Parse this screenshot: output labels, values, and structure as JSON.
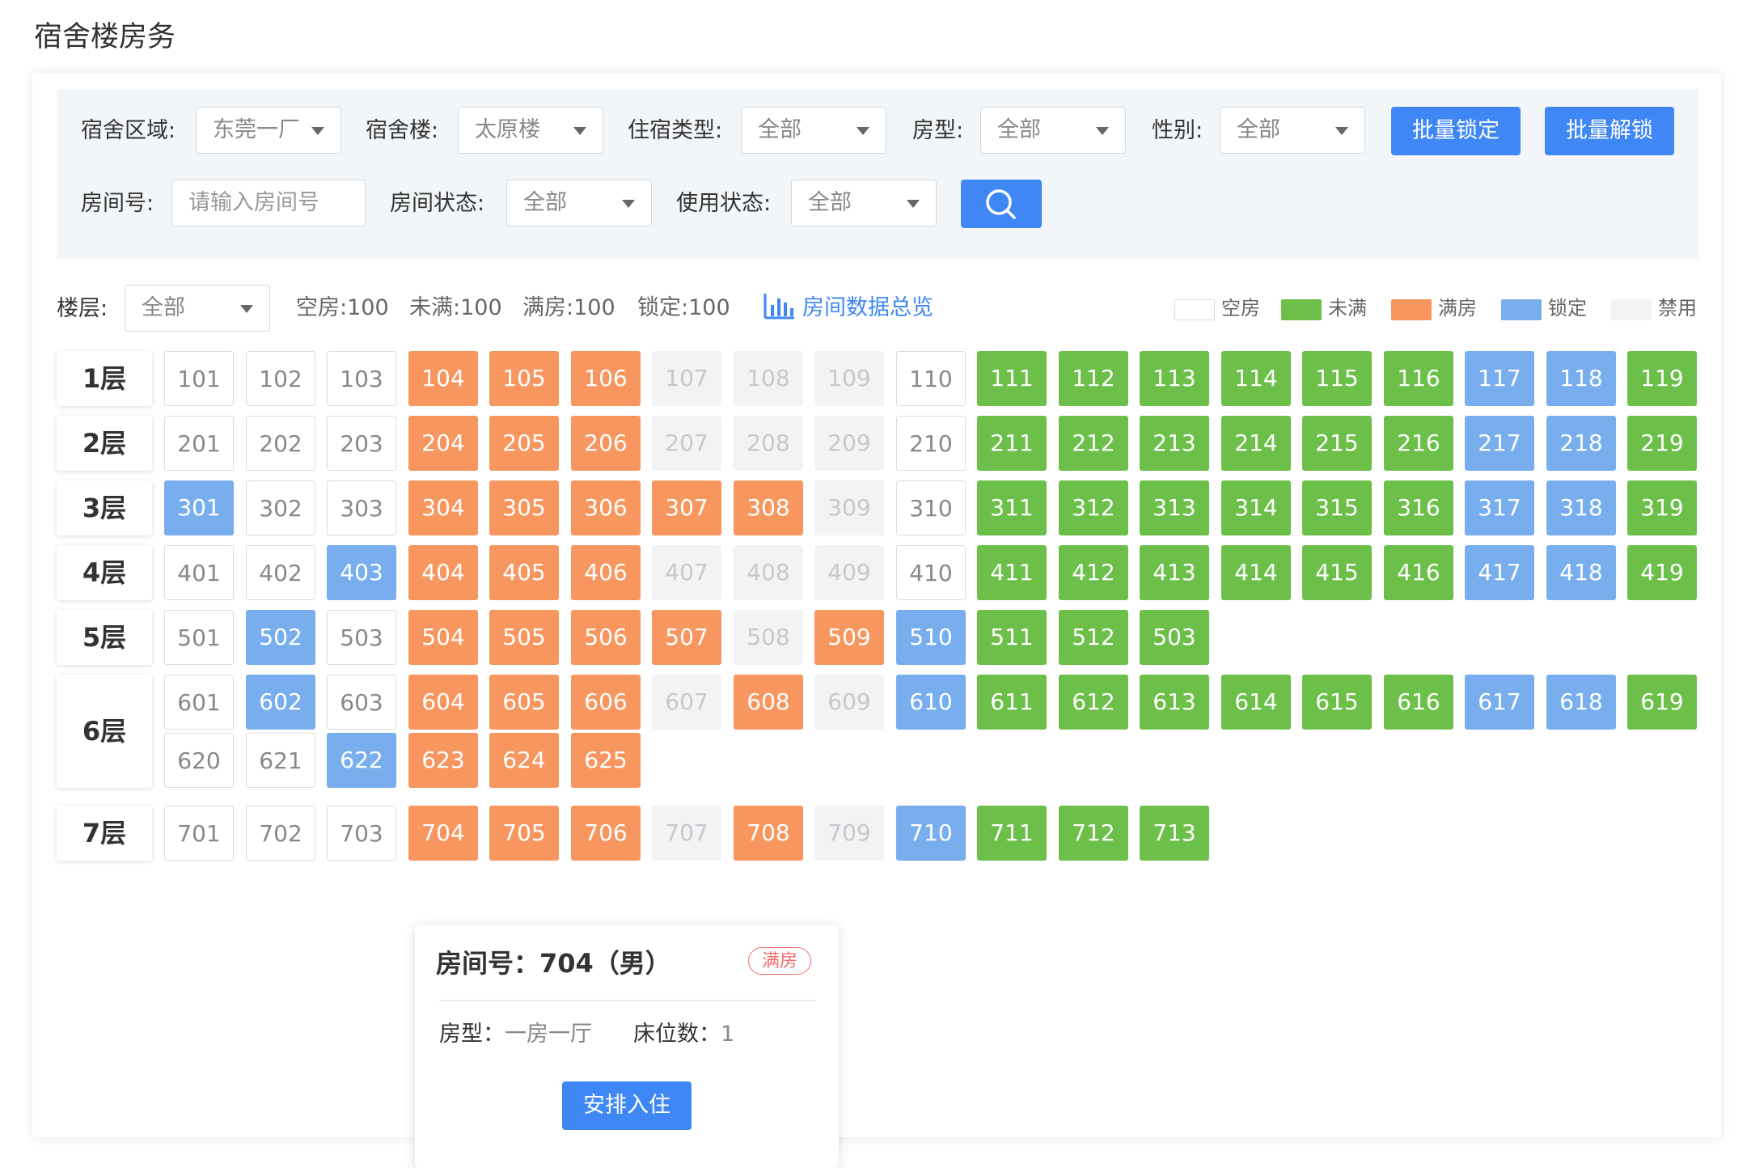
{
  "page_title": "宿舍楼房务",
  "filters": {
    "area_label": "宿舍区域:",
    "area_value": "东莞一厂",
    "building_label": "宿舍楼:",
    "building_value": "太原楼",
    "stay_type_label": "住宿类型:",
    "stay_type_value": "全部",
    "room_type_label": "房型:",
    "room_type_value": "全部",
    "gender_label": "性别:",
    "gender_value": "全部",
    "batch_lock": "批量锁定",
    "batch_unlock": "批量解锁",
    "room_no_label": "房间号:",
    "room_no_placeholder": "请输入房间号",
    "room_status_label": "房间状态:",
    "room_status_value": "全部",
    "use_status_label": "使用状态:",
    "use_status_value": "全部",
    "search_icon": "search-icon"
  },
  "floor_filter": {
    "label": "楼层:",
    "value": "全部"
  },
  "stats": {
    "empty": "空房:100",
    "not_full": "未满:100",
    "full": "满房:100",
    "locked": "锁定:100"
  },
  "overview": {
    "icon": "bar-chart-icon",
    "label": "房间数据总览"
  },
  "legend": [
    {
      "label": "空房",
      "color": "#ffffff"
    },
    {
      "label": "未满",
      "color": "#6cc04a"
    },
    {
      "label": "满房",
      "color": "#f7975f"
    },
    {
      "label": "锁定",
      "color": "#78aeee"
    },
    {
      "label": "禁用",
      "color": "#f3f3f5"
    }
  ],
  "status_colors": {
    "E": "empty",
    "G": "not-full",
    "O": "full",
    "B": "locked",
    "D": "disabled"
  },
  "floors": [
    {
      "label": "1层",
      "rows": [
        {
          "rooms": [
            "101",
            "102",
            "103",
            "104",
            "105",
            "106",
            "107",
            "108",
            "109",
            "110",
            "111",
            "112",
            "113",
            "114",
            "115",
            "116",
            "117",
            "118",
            "119"
          ],
          "status": "EEEOOODDDEGGGGGGBBG"
        }
      ]
    },
    {
      "label": "2层",
      "rows": [
        {
          "rooms": [
            "201",
            "202",
            "203",
            "204",
            "205",
            "206",
            "207",
            "208",
            "209",
            "210",
            "211",
            "212",
            "213",
            "214",
            "215",
            "216",
            "217",
            "218",
            "219"
          ],
          "status": "EEEOOODDDEGGGGGGBBG"
        }
      ]
    },
    {
      "label": "3层",
      "rows": [
        {
          "rooms": [
            "301",
            "302",
            "303",
            "304",
            "305",
            "306",
            "307",
            "308",
            "309",
            "310",
            "311",
            "312",
            "313",
            "314",
            "315",
            "316",
            "317",
            "318",
            "319"
          ],
          "status": "BEEOOOOODEGGGGGGBBG"
        }
      ]
    },
    {
      "label": "4层",
      "rows": [
        {
          "rooms": [
            "401",
            "402",
            "403",
            "404",
            "405",
            "406",
            "407",
            "408",
            "409",
            "410",
            "411",
            "412",
            "413",
            "414",
            "415",
            "416",
            "417",
            "418",
            "419"
          ],
          "status": "EEBOOODDDEGGGGGGBBG"
        }
      ]
    },
    {
      "label": "5层",
      "rows": [
        {
          "rooms": [
            "501",
            "502",
            "503",
            "504",
            "505",
            "506",
            "507",
            "508",
            "509",
            "510",
            "511",
            "512",
            "503"
          ],
          "status": "EBEOOOODOBGGG"
        }
      ]
    },
    {
      "label": "6层",
      "rows": [
        {
          "rooms": [
            "601",
            "602",
            "603",
            "604",
            "605",
            "606",
            "607",
            "608",
            "609",
            "610",
            "611",
            "612",
            "613",
            "614",
            "615",
            "616",
            "617",
            "618",
            "619"
          ],
          "status": "EBEOOODODBGGGGGGBBG"
        },
        {
          "rooms": [
            "620",
            "621",
            "622",
            "623",
            "624",
            "625"
          ],
          "status": "EEBOOO"
        }
      ]
    },
    {
      "label": "7层",
      "rows": [
        {
          "rooms": [
            "701",
            "702",
            "703",
            "704",
            "705",
            "706",
            "707",
            "708",
            "709",
            "710",
            "711",
            "712",
            "713"
          ],
          "status": "EEEOOODODBGGG"
        }
      ]
    }
  ],
  "popup": {
    "title": "房间号：704（男）",
    "badge": "满房",
    "room_type_label": "房型：",
    "room_type_value": "一房一厅",
    "beds_label": "床位数：",
    "beds_value": "1",
    "action": "安排入住"
  }
}
